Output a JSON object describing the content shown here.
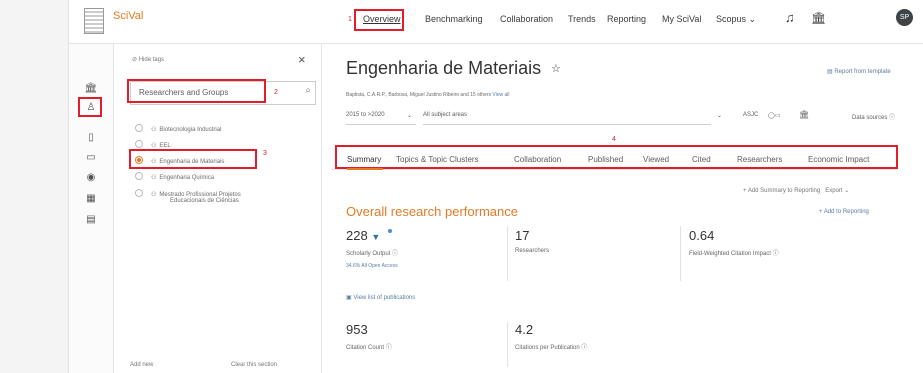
{
  "brand": "SciVal",
  "nav": {
    "overview": "Overview",
    "benchmarking": "Benchmarking",
    "collaboration": "Collaboration",
    "trends": "Trends",
    "reporting": "Reporting",
    "my_scival": "My SciVal",
    "scopus": "Scopus",
    "avatar": "SP",
    "annotation": "1"
  },
  "sidebar": {
    "hide_tags": "Hide tags",
    "search_label": "Researchers and Groups",
    "annotation_search": "2",
    "annotation_item": "3",
    "items": [
      {
        "label": "Biotecnologia Industrial",
        "selected": false
      },
      {
        "label": "EEL",
        "selected": false
      },
      {
        "label": "Engenharia de Materiais",
        "selected": true
      },
      {
        "label": "Engenharia Química",
        "selected": false
      },
      {
        "label": "Mestrado Profissional Projetos",
        "label2": "Educacionais de Ciências",
        "selected": false
      }
    ],
    "footer_left": "Add new",
    "footer_right": "Clear this section"
  },
  "main": {
    "title": "Engenharia de Materiais",
    "report_link": "Report from template",
    "authors": "Baptista, C.A.R.P., Barbosa, Miguel Justino Ribeiro and 15 others",
    "view_all": "View all",
    "date_range": "2015 to >2020",
    "subject_areas": "All subject areas",
    "asjc": "ASJC",
    "data_sources": "Data sources",
    "annotation_tabs": "4",
    "tabs": [
      {
        "label": "Summary"
      },
      {
        "label": "Topics & Topic Clusters"
      },
      {
        "label": "Collaboration"
      },
      {
        "label": "Published"
      },
      {
        "label": "Viewed"
      },
      {
        "label": "Cited"
      },
      {
        "label": "Researchers"
      },
      {
        "label": "Economic Impact"
      }
    ],
    "add_summary": "+ Add Summary to Reporting",
    "export": "Export",
    "section_title": "Overall research performance",
    "add_to_reporting": "+ Add to Reporting",
    "metrics": {
      "scholarly_output": {
        "value": "228",
        "label": "Scholarly Output",
        "sub": "34.6% All Open Access"
      },
      "researchers": {
        "value": "17",
        "label": "Researchers"
      },
      "fwci": {
        "value": "0.64",
        "label": "Field-Weighted Citation Impact"
      },
      "citation_count": {
        "value": "953",
        "label": "Citation Count"
      },
      "citations_per_pub": {
        "value": "4.2",
        "label": "Citations per Publication"
      }
    },
    "view_publications": "View list of publications"
  }
}
